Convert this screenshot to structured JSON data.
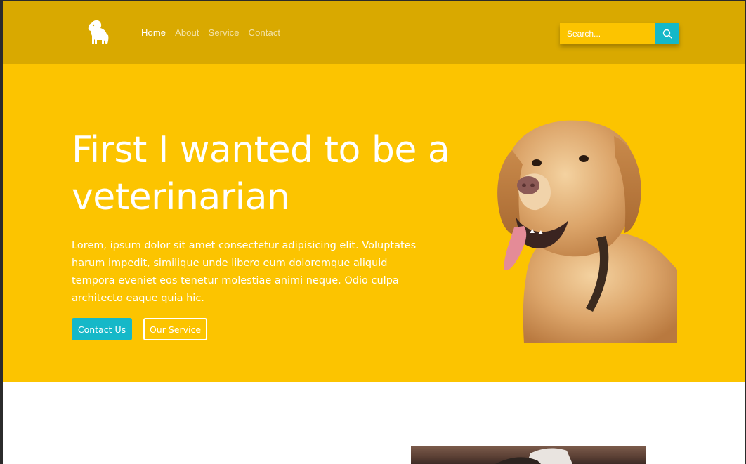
{
  "nav": {
    "items": [
      {
        "label": "Home",
        "active": true
      },
      {
        "label": "About",
        "active": false
      },
      {
        "label": "Service",
        "active": false
      },
      {
        "label": "Contact",
        "active": false
      }
    ]
  },
  "search": {
    "placeholder": "Search...",
    "icon": "search-icon"
  },
  "hero": {
    "title": "First I wanted to be a veterinarian",
    "text": "Lorem, ipsum dolor sit amet consectetur adipisicing elit. Voluptates harum impedit, similique unde libero eum doloremque aliquid tempora eveniet eos tenetur molestiae animi neque. Odio culpa architecto eaque quia hic.",
    "contact_button": "Contact Us",
    "service_button": "Our Service"
  },
  "colors": {
    "header_bg": "#d9a900",
    "hero_bg": "#fcc400",
    "accent": "#15b8c8",
    "text_light": "#ffffff"
  },
  "icons": {
    "logo": "dog-logo-icon",
    "hero_image": "golden-retriever-image"
  }
}
